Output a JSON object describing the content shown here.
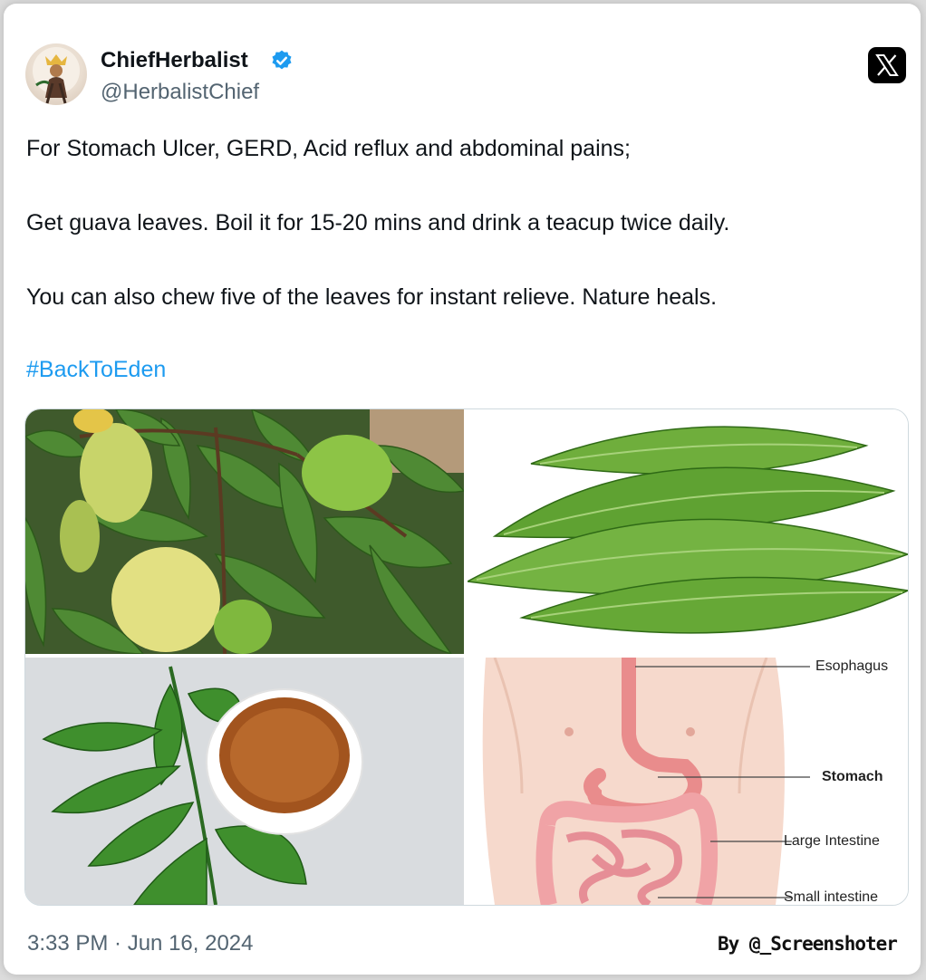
{
  "tweet": {
    "author_name": "ChiefHerbalist",
    "author_handle": "@HerbalistChief",
    "verified": true,
    "paragraphs": [
      "For Stomach Ulcer, GERD, Acid reflux and abdominal pains;",
      "Get guava leaves. Boil it for 15-20 mins and drink a teacup twice daily.",
      "You can also chew five of the leaves for instant relieve. Nature heals."
    ],
    "hashtag": "#BackToEden",
    "timestamp": "3:33 PM · Jun 16, 2024"
  },
  "media": {
    "anatomy_labels": {
      "esophagus": "Esophagus",
      "stomach": "Stomach",
      "large_intestine": "Large Intestine",
      "small_intestine": "Small intestine"
    }
  },
  "watermark": "By @_Screenshoter",
  "icons": {
    "platform_logo": "x-logo-icon",
    "verified_badge": "verified-badge-icon"
  },
  "colors": {
    "hashtag": "#1d9bf0",
    "verified": "#1d9bf0",
    "secondary_text": "#536471"
  }
}
